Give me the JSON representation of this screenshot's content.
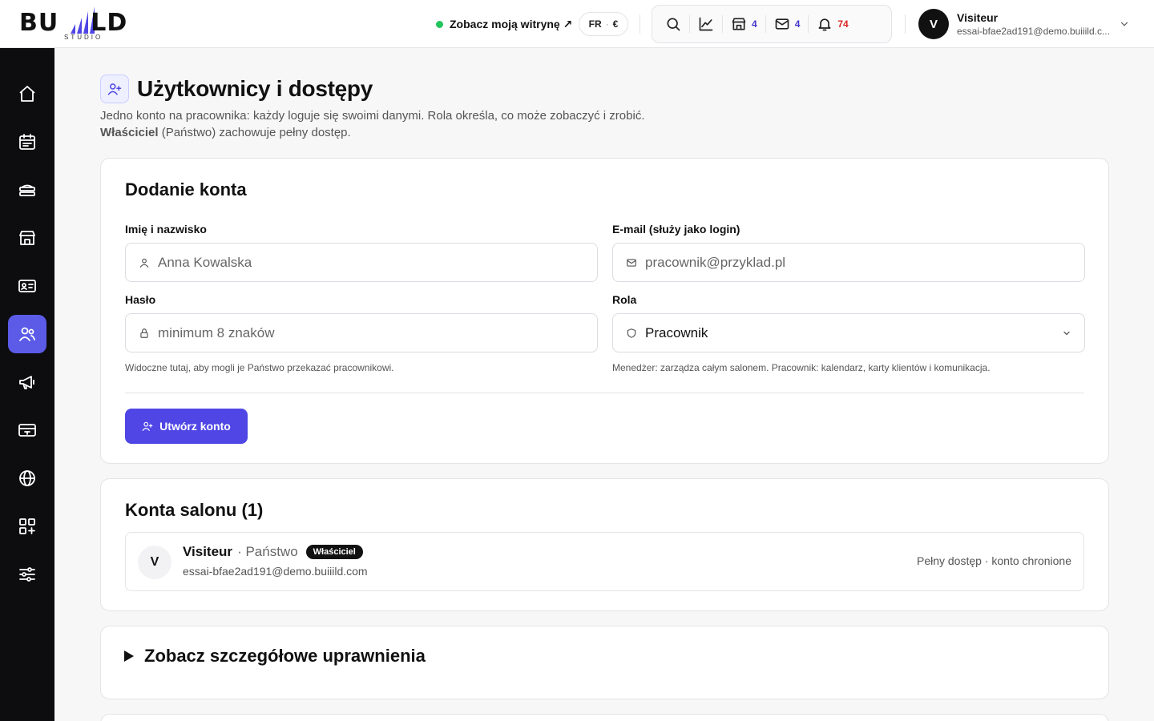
{
  "brand": {
    "logo_main": "BUIILD",
    "logo_sub": "STUDIO"
  },
  "header": {
    "site_link": "Zobacz moją witrynę ↗",
    "lang": "FR",
    "currency": "€",
    "salon_count": "4",
    "messages_count": "4",
    "notifications_count": "74"
  },
  "user": {
    "initial": "V",
    "name": "Visiteur",
    "email": "essai-bfae2ad191@demo.buiiild.c..."
  },
  "page": {
    "title": "Użytkownicy i dostępy",
    "intro_line1": "Jedno konto na pracownika: każdy loguje się swoimi danymi. Rola określa, co może zobaczyć i zrobić.",
    "intro_owner": "Właściciel",
    "intro_line2_rest": " (Państwo) zachowuje pełny dostęp."
  },
  "add_form": {
    "title": "Dodanie konta",
    "name_label": "Imię i nazwisko",
    "name_placeholder": "Anna Kowalska",
    "email_label": "E-mail (służy jako login)",
    "email_placeholder": "pracownik@przyklad.pl",
    "password_label": "Hasło",
    "password_placeholder": "minimum 8 znaków",
    "role_label": "Rola",
    "role_value": "Pracownik",
    "password_hint": "Widoczne tutaj, aby mogli je Państwo przekazać pracownikowi.",
    "role_hint": "Menedżer: zarządza całym salonem. Pracownik: kalendarz, karty klientów i komunikacja.",
    "submit_label": "Utwórz konto"
  },
  "accounts": {
    "title": "Konta salonu (1)",
    "items": [
      {
        "initial": "V",
        "name": "Visiteur",
        "role": "· Państwo",
        "badge": "Właściciel",
        "email": "essai-bfae2ad191@demo.buiiild.com",
        "status": "Pełny dostęp · konto chronione"
      }
    ]
  },
  "permissions": {
    "title": "Zobacz szczegółowe uprawnienia"
  },
  "colors": {
    "accent": "#4f46e5",
    "sidebar_active": "#5b5be8",
    "sidebar_bg": "#0d0d10",
    "online": "#22c55e",
    "alert": "#dc2626"
  }
}
